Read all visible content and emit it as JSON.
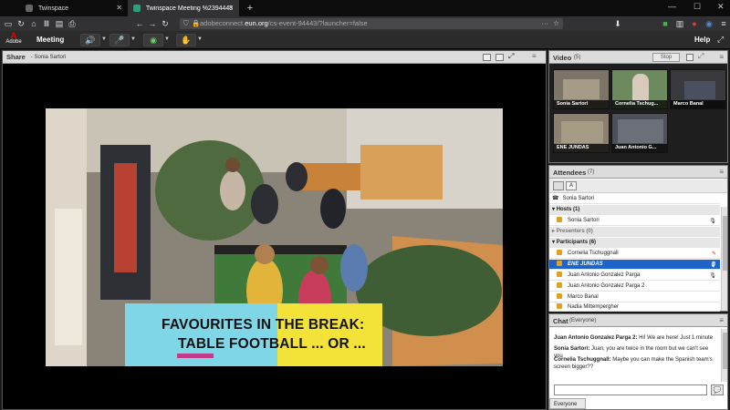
{
  "browser": {
    "tabs": [
      {
        "label": "Twinspace"
      },
      {
        "label": "Twinspace Meeting %2394443"
      }
    ],
    "url_prefix": "adobeconnect.",
    "url_domain": "eun.org",
    "url_path": "/cs-event-94443/?launcher=false"
  },
  "acbar": {
    "logo": "Adobe",
    "meeting_menu": "Meeting",
    "help_menu": "Help"
  },
  "share": {
    "title": "Share",
    "presenter": "- Sonia Sartori",
    "banner_line1": "FAVOURITES IN THE BREAK:",
    "banner_line2": "TABLE FOOTBALL ... OR ..."
  },
  "video_pod": {
    "title": "Video",
    "count": "(5)",
    "stop_label": "Stop",
    "thumbs": [
      {
        "name": "Sonia Sartori"
      },
      {
        "name": "Cornelia Tschug..."
      },
      {
        "name": "Marco Banal"
      },
      {
        "name": "ENE JUNDAS"
      },
      {
        "name": "Juan Antonio G..."
      }
    ]
  },
  "attendees": {
    "title": "Attendees",
    "count": "(7)",
    "me": "Sonia Sartori",
    "hosts_label": "Hosts (1)",
    "hosts": [
      "Sonia Sartori"
    ],
    "presenters_label": "Presenters (0)",
    "participants_label": "Participants (6)",
    "participants": [
      "Cornelia Tschuggnall",
      "ENE JUNDAS",
      "Juan Antonio Gonzalez Parga",
      "Juan Antonio Gonzalez Parga 2",
      "Marco Banal",
      "Nadia Mittempergher"
    ]
  },
  "chat": {
    "title": "Chat",
    "scope": "(Everyone)",
    "messages": [
      {
        "sender": "Juan Antonio Gonzalez Parga 2:",
        "text": "Hi! We are here! Just 1 minute"
      },
      {
        "sender": "Sonia Sartori:",
        "text": "Juan, you are twice in the room but we can't see you"
      },
      {
        "sender": "Cornelia Tschuggnall:",
        "text": "Maybe you can make the Spanish team's screen bigger??"
      }
    ],
    "target": "Everyone"
  },
  "colors": {
    "selected_row": "#1d63c8",
    "banner_cyan": "#7fd6e6",
    "banner_yellow": "#f3e338"
  }
}
